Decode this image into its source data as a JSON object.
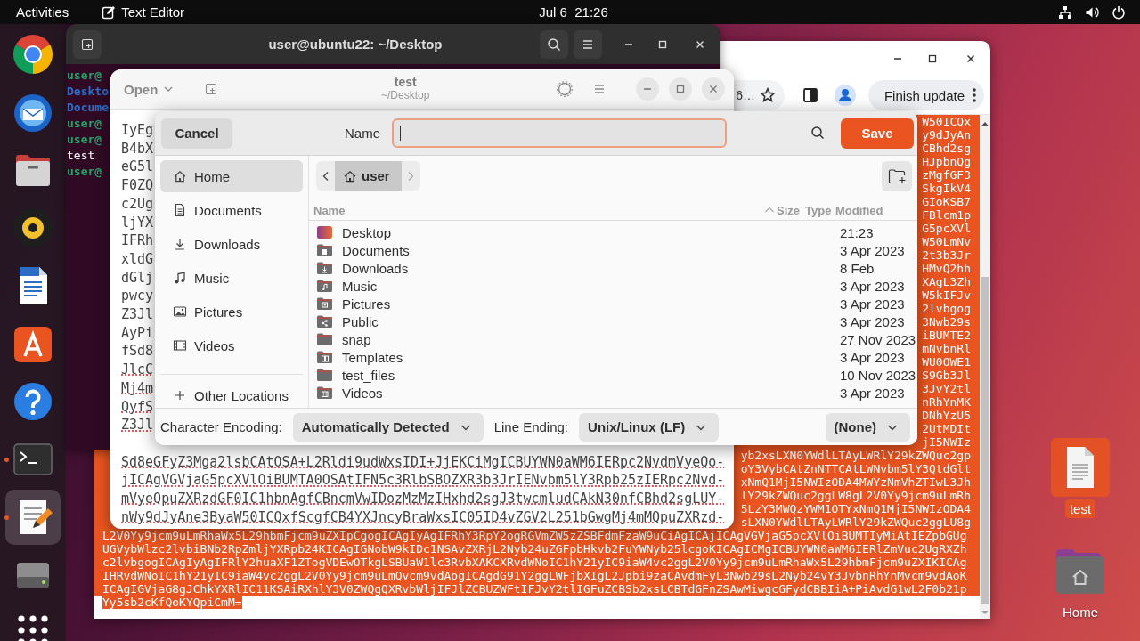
{
  "top_bar": {
    "activities": "Activities",
    "app_name": "Text Editor",
    "clock": "Jul 6  21:26"
  },
  "dock": {
    "items": [
      {
        "kind": "browser",
        "running": false,
        "selected": false
      },
      {
        "kind": "mail",
        "running": false,
        "selected": false
      },
      {
        "kind": "files",
        "running": false,
        "selected": false
      },
      {
        "kind": "music",
        "running": false,
        "selected": false
      },
      {
        "kind": "writer",
        "running": false,
        "selected": false
      },
      {
        "kind": "store",
        "running": false,
        "selected": false
      },
      {
        "kind": "help",
        "running": false,
        "selected": false
      },
      {
        "kind": "terminal",
        "running": true,
        "selected": false
      },
      {
        "kind": "editor",
        "running": true,
        "selected": true
      },
      {
        "kind": "drive",
        "running": false,
        "selected": false
      },
      {
        "kind": "apps",
        "running": false,
        "selected": false
      }
    ]
  },
  "terminal": {
    "title": "user@ubuntu22: ~/Desktop",
    "lines": [
      {
        "kind": "prompt",
        "text": "user@"
      },
      {
        "kind": "dir",
        "text": "Deskto"
      },
      {
        "kind": "dir",
        "text": "Docume"
      },
      {
        "kind": "prompt",
        "text": "user@"
      },
      {
        "kind": "prompt",
        "text": "user@"
      },
      {
        "kind": "plain",
        "text": "test"
      },
      {
        "kind": "prompt",
        "text": "user@"
      }
    ]
  },
  "browser": {
    "address": "6…",
    "update_button": "Finish update",
    "rows": [
      {
        "kind": "tail",
        "text": "W50ICQx"
      },
      {
        "kind": "tail",
        "text": "y9dJyAn"
      },
      {
        "kind": "tail",
        "text": "CBhd2sg"
      },
      {
        "kind": "tail",
        "text": "HJpbnQg"
      },
      {
        "kind": "tail",
        "text": "zMgfGF3"
      },
      {
        "kind": "tail",
        "text": "SkgIkV4"
      },
      {
        "kind": "tail",
        "text": "GIoKSB7"
      },
      {
        "kind": "tail",
        "text": "FBlcm1p"
      },
      {
        "kind": "tail",
        "text": "G5pcXVl"
      },
      {
        "kind": "tail",
        "text": "W50LmNv"
      },
      {
        "kind": "tail",
        "text": "2t3b3Jr"
      },
      {
        "kind": "tail",
        "text": "HMvQ2hh"
      },
      {
        "kind": "tail",
        "text": "XAgL3Zh"
      },
      {
        "kind": "tail",
        "text": "W5kIFJv"
      },
      {
        "kind": "tail",
        "text": "2lvbgog"
      },
      {
        "kind": "tail",
        "text": "3Nwb29s"
      },
      {
        "kind": "tail",
        "text": "iBUMTE2"
      },
      {
        "kind": "tail",
        "text": "mNvbnRl"
      },
      {
        "kind": "tail",
        "text": "WU0OWE1"
      },
      {
        "kind": "tail",
        "text": "S9Gb3Jl"
      },
      {
        "kind": "tail",
        "text": "3JvY2tl"
      },
      {
        "kind": "tail",
        "text": "nRhYnMK"
      },
      {
        "kind": "tail",
        "text": "DNhYzU5"
      },
      {
        "kind": "tail",
        "text": "2UtMDIt"
      },
      {
        "kind": "tail",
        "text": "jI5NWIz"
      },
      {
        "kind": "tail",
        "text": "yb2xsLXN0YWdlLTAyLWRlY29kZWQuc2gp"
      },
      {
        "kind": "tail",
        "text": "oY3VybCAtZnNTTCAtLWNvbm5lY3QtdGlt"
      },
      {
        "kind": "tail",
        "text": "xNmQ1MjI5NWIzODA4MWYzNmVhZTIwL3Jh"
      },
      {
        "kind": "tail",
        "text": "lY29kZWQuc2ggLW8gL2V0Yy9jcm9uLmRh"
      },
      {
        "kind": "tail",
        "text": "5LzY3MWQzYWM1OTYxNmQ1MjI5NWIzODA4"
      },
      {
        "kind": "tail",
        "text": "sLXN0YWdlLTAyLWRlY29kZWQuc2ggLU8g"
      },
      {
        "kind": "full",
        "text": "L2V0Yy9jcm9uLmRhaWx5L29hbmFjcm9uZXIpCgogICAgIyAgIFRhY3RpY2ogRGVmZW5zZSBFdmFzaW9uCiAgICAjICAgVGVjaG5pcXVlOiBUMTIyMiAtIEZpbGUg"
      },
      {
        "kind": "full",
        "text": "UGVybWlzc2lvbiBNb2RpZmljYXRpb24KICAgIGNobW9kIDc1NSAvZXRjL2Nyb24uZGFpbHkvb2FuYWNyb25lcgoKICAgICMgICBUYWN0aWM6IERlZmVuc2UgRXZh"
      },
      {
        "kind": "full",
        "text": "c2lvbgogICAgIyAgIFRlY2huaXF1ZTogVDEwOTkgLSBUaW1lc3RvbXAKCXRvdWNoIC1hY21yIC9iaW4vc2ggL2V0Yy9jcm9uLmRhaWx5L29hbmFjcm9uZXIKICAg"
      },
      {
        "kind": "full",
        "text": "IHRvdWNoIC1hY21yIC9iaW4vc2ggL2V0Yy9jcm9uLmQvcm9vdAogICAgdG91Y2ggLWFjbXIgL2Jpbi9zaCAvdmFyL3Nwb29sL2Nyb24vY3JvbnRhYnMvcm9vdAoK"
      },
      {
        "kind": "full",
        "text": "ICAgIGVjaG8gJChkYXRlIC11KSAiRXhlY3V0ZWQgQXRvbWljIFJlZCBUZWFtIFJvY2tlIGFuZCBSb2xsLCBTdGFnZSAwMiwgcGFydCBBIiA+PiAvdG1wL2F0b21p"
      },
      {
        "kind": "end",
        "text": "Yy5sb2cKfQoKYQpiCmM="
      }
    ]
  },
  "editor": {
    "open_button": "Open",
    "title": "test",
    "subtitle": "~/Desktop",
    "lines": [
      {
        "text": "IyEg",
        "misspelled": false
      },
      {
        "text": "B4bX",
        "misspelled": false
      },
      {
        "text": "eG5l",
        "misspelled": false
      },
      {
        "text": "F0ZQ",
        "misspelled": false
      },
      {
        "text": "c2Ug",
        "misspelled": false
      },
      {
        "text": "ljYX",
        "misspelled": false
      },
      {
        "text": "IFRh",
        "misspelled": false
      },
      {
        "text": "xldG",
        "misspelled": false
      },
      {
        "text": "dGlj",
        "misspelled": false
      },
      {
        "text": "pwcy",
        "misspelled": false
      },
      {
        "text": "Z3Jl",
        "misspelled": false
      },
      {
        "text": "AyPi",
        "misspelled": false
      },
      {
        "text": "fSd8",
        "misspelled": false
      },
      {
        "text": "JlcC",
        "misspelled": true
      },
      {
        "text": "Mj4m",
        "misspelled": true
      },
      {
        "text": "QyfS",
        "misspelled": true
      },
      {
        "text": "Z3Jl",
        "misspelled": true
      }
    ],
    "lines_below": [
      {
        "text": "Sd8eGFyZ3Mga2lsbCAtOSA+L2Rldi9udWxsIDI+JjEKCiMgICBUYWN0aWM6IERpc2NvdmVyeQo-",
        "misspelled": true
      },
      {
        "text": "jICAgVGVjaG5pcXVlOiBUMTA0OSAtIFN5c3RlbSBOZXR3b3JrIENvbm5lY3Rpb25zIERpc2Nvd-",
        "misspelled": true
      },
      {
        "text": "mVyeQpuZXRzdGF0IC1hbnAgfCBncmVwIDozMzMzIHxhd2sgJ3twcmludCAkN30nfCBhd2sgLUY-",
        "misspelled": true
      },
      {
        "text": "nWy9dJyAne3ByaW50ICQxfScgfCB4YXJncyBraWxsIC05ID4vZGV2L251bGwgMj4mMQpuZXRzd-",
        "misspelled": true
      }
    ]
  },
  "save_dialog": {
    "cancel_button": "Cancel",
    "name_label": "Name",
    "name_field": {
      "focused": true
    },
    "save_button": "Save",
    "places": [
      {
        "kind": "home",
        "label": "Home",
        "selected": true
      },
      {
        "kind": "documents",
        "label": "Documents",
        "selected": false
      },
      {
        "kind": "downloads",
        "label": "Downloads",
        "selected": false
      },
      {
        "kind": "music",
        "label": "Music",
        "selected": false
      },
      {
        "kind": "pictures",
        "label": "Pictures",
        "selected": false
      },
      {
        "kind": "videos",
        "label": "Videos",
        "selected": false
      }
    ],
    "other_locations": "Other Locations",
    "path": [
      {
        "label": "user",
        "selected": true
      }
    ],
    "columns": [
      "Name",
      "Size",
      "Type",
      "Modified"
    ],
    "files": [
      {
        "kind": "desktop",
        "name": "Desktop",
        "modified": "21:23"
      },
      {
        "kind": "documents",
        "name": "Documents",
        "modified": "3 Apr 2023"
      },
      {
        "kind": "downloads",
        "name": "Downloads",
        "modified": "8 Feb"
      },
      {
        "kind": "music",
        "name": "Music",
        "modified": "3 Apr 2023"
      },
      {
        "kind": "pictures",
        "name": "Pictures",
        "modified": "3 Apr 2023"
      },
      {
        "kind": "public",
        "name": "Public",
        "modified": "3 Apr 2023"
      },
      {
        "kind": "plain",
        "name": "snap",
        "modified": "27 Nov 2023"
      },
      {
        "kind": "templates",
        "name": "Templates",
        "modified": "3 Apr 2023"
      },
      {
        "kind": "plain",
        "name": "test_files",
        "modified": "10 Nov 2023"
      },
      {
        "kind": "videos",
        "name": "Videos",
        "modified": "3 Apr 2023"
      }
    ],
    "encoding_label": "Character Encoding:",
    "encoding": "Automatically Detected",
    "line_ending_label": "Line Ending:",
    "line_ending": "Unix/Linux (LF)",
    "highlight": "(None)"
  },
  "desktop_icons": [
    {
      "kind": "file",
      "label": "test",
      "selected": true
    },
    {
      "kind": "home",
      "label": "Home",
      "selected": false
    }
  ]
}
